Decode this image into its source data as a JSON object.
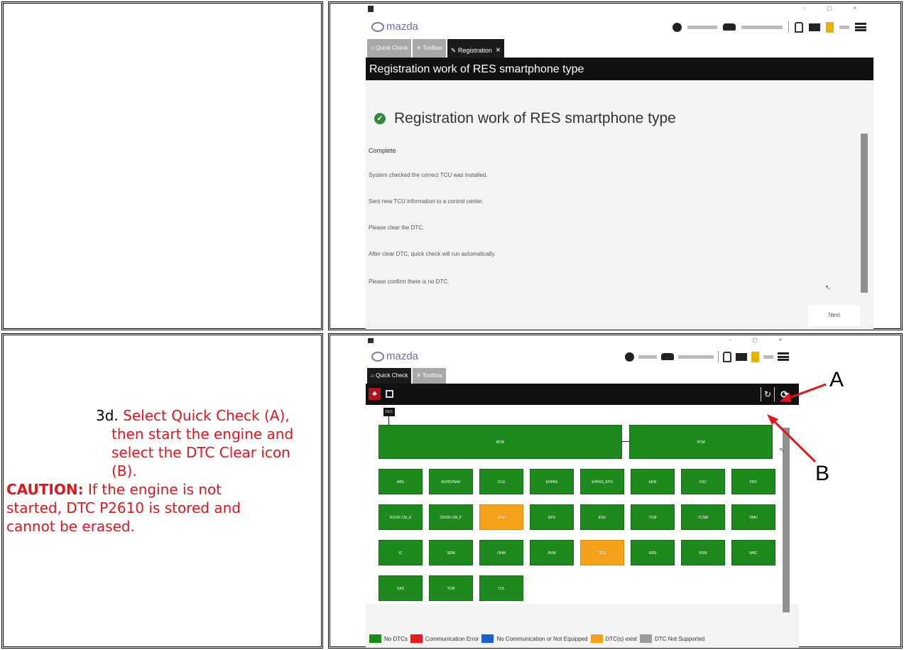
{
  "instruction": {
    "step_number": "3d.",
    "step_text_line1": "Select Quick Check (A),",
    "step_text_line2": "then start the engine and",
    "step_text_line3": "select the DTC Clear icon (B).",
    "caution_label": "CAUTION:",
    "caution_line1": "If the engine is not",
    "caution_line2": "started, DTC P2610 is stored and",
    "caution_line3": "cannot be erased."
  },
  "colors": {
    "instruction_red": "#e8141b",
    "no_dtc_green": "#1e8a1e",
    "dtc_exist_orange": "#f5a21b",
    "comm_error_red": "#e81b1b",
    "no_comm_blue": "#1b5fd0",
    "not_supported_gray": "#9a9a9a",
    "toolbar_red": "#b0121b"
  },
  "screen1": {
    "brand": "mazda",
    "tabs": [
      {
        "label": "Quick Check",
        "active": false
      },
      {
        "label": "Toolbox",
        "active": false
      },
      {
        "label": "Registration",
        "active": true
      }
    ],
    "close_glyph": "×",
    "header_title": "Registration work of RES smartphone type",
    "status_heading": "Registration work of RES smartphone type",
    "messages": [
      "Complete",
      "System checked the correct TCU was installed.",
      "Sent new TCU information to a control center.",
      "Please clear the DTC.",
      "After clear DTC, quick check will run automatically.",
      "Please confirm there is no DTC."
    ],
    "next_button": "Next"
  },
  "screen2": {
    "brand": "mazda",
    "tabs": [
      {
        "label": "Quick Check",
        "active": true
      },
      {
        "label": "Toolbox",
        "active": false
      }
    ],
    "root_node": "DLC",
    "modules": [
      "BCM",
      "PCM",
      "ABS",
      "AUDIO/NAV",
      "CCU",
      "EHPAS",
      "EHPAS_EPS",
      "EKM",
      "FSC",
      "FRC",
      "DOOR CM_D",
      "DOOR CM_P",
      "ECU",
      "EPS",
      "ESU",
      "TCM",
      "TCSM",
      "PMU",
      "IC",
      "SDM",
      "OHM",
      "RVM",
      "TCU",
      "RRS",
      "RSM",
      "WBC",
      "SAS",
      "TCM",
      "TCL"
    ],
    "legend": [
      {
        "label": "No DTCs"
      },
      {
        "label": "Communication Error"
      },
      {
        "label": "No Communication or Not Equipped"
      },
      {
        "label": "DTC(s) exist"
      },
      {
        "label": "DTC Not Supported"
      }
    ]
  },
  "callouts": {
    "a": "A",
    "b": "B"
  }
}
